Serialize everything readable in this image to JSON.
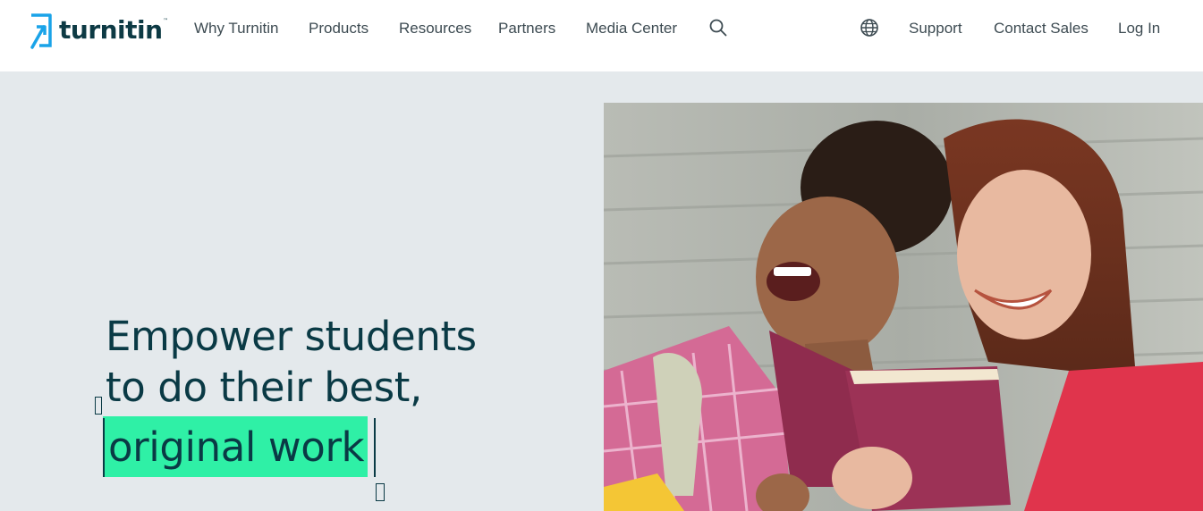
{
  "brand": {
    "name": "turnitin",
    "trademark": "™",
    "accent": "#1aa3e8"
  },
  "nav": {
    "items": [
      "Why Turnitin",
      "Products",
      "Resources",
      "Partners",
      "Media Center"
    ],
    "search_icon": "search-icon",
    "globe_icon": "globe-icon",
    "support": "Support",
    "contact_sales": "Contact Sales",
    "log_in": "Log In"
  },
  "hero": {
    "line1": "Empower students",
    "line2": "to do their best,",
    "highlight": "original work",
    "highlight_color": "#2ff0a6",
    "background": "#e4e9ec"
  }
}
